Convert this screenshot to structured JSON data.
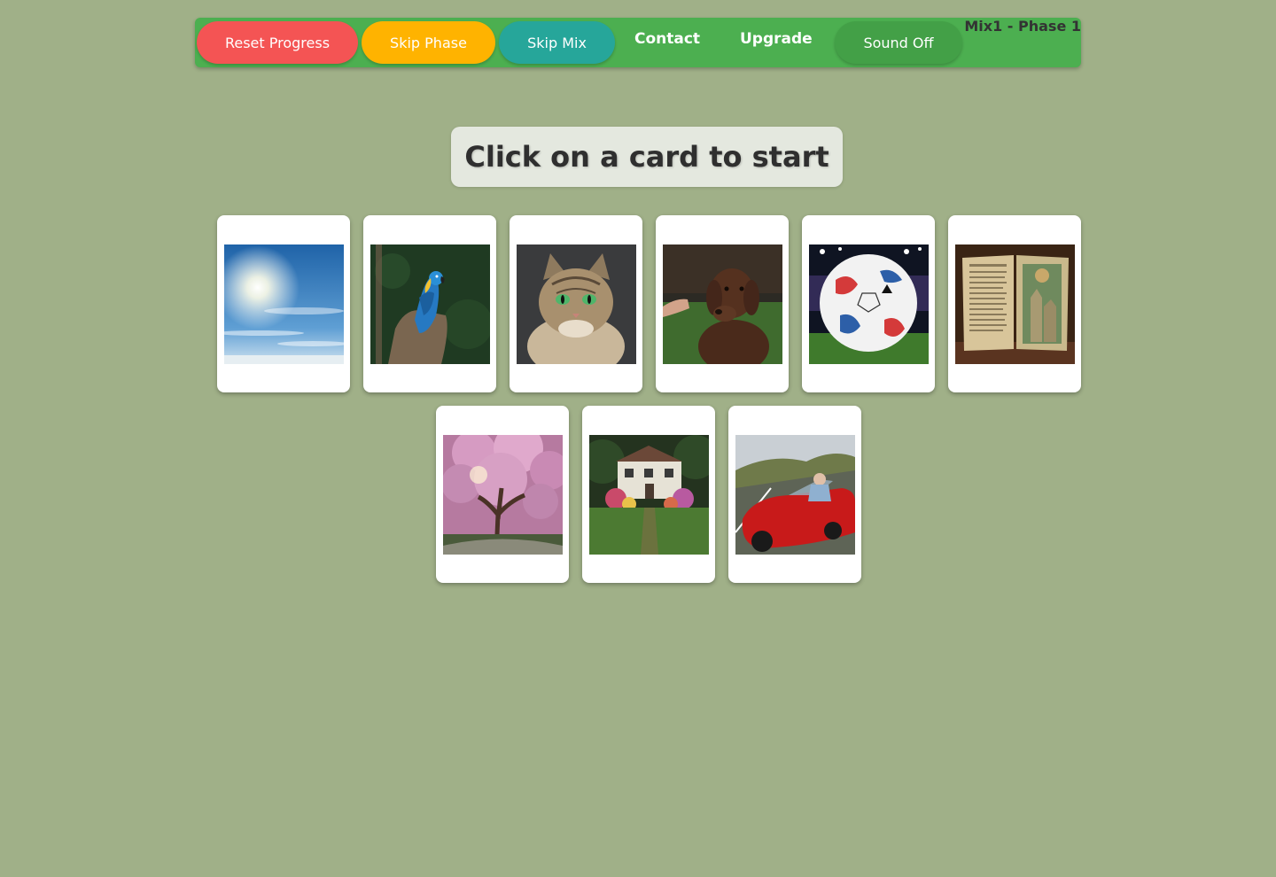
{
  "toolbar": {
    "reset_label": "Reset Progress",
    "skip_phase_label": "Skip Phase",
    "skip_mix_label": "Skip Mix",
    "contact_label": "Contact",
    "upgrade_label": "Upgrade",
    "sound_label": "Sound Off",
    "phase_label": "Mix1 - Phase 1"
  },
  "prompt": "Click on a card to start",
  "cards": [
    {
      "image": "sunny-sky"
    },
    {
      "image": "macaw-parrot"
    },
    {
      "image": "tabby-cat"
    },
    {
      "image": "chocolate-labrador"
    },
    {
      "image": "soccer-ball"
    },
    {
      "image": "open-storybook"
    },
    {
      "image": "cherry-blossom-tree"
    },
    {
      "image": "country-cottage"
    },
    {
      "image": "red-convertible-car"
    }
  ],
  "colors": {
    "background": "#a0b088",
    "toolbar": "#4caf50",
    "reset": "#f45454",
    "skip_phase": "#ffb300",
    "skip_mix": "#26a69a",
    "sound": "#43a047"
  }
}
